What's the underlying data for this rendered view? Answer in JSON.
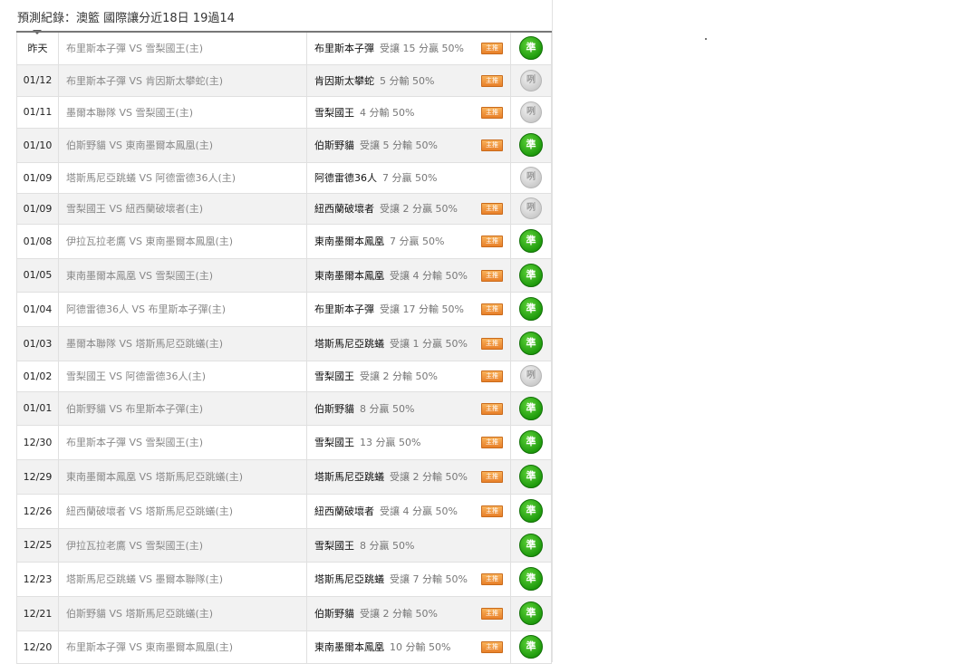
{
  "header": {
    "title": "預測紀錄：澳籃 國際讓分近18日 19過14"
  },
  "tag_label": "主推",
  "result_labels": {
    "win": "準",
    "draw": "咧"
  },
  "colors": {
    "win_green": "#1f9b0d",
    "draw_gray": "#c9c9c9",
    "tag_orange": "#e8802a"
  },
  "rows": [
    {
      "date": "昨天",
      "match": "布里斯本子彈 VS 雪梨國王(主)",
      "pick": "布里斯本子彈",
      "detail": "受讓 15 分贏 50%",
      "tag": true,
      "result": "win"
    },
    {
      "date": "01/12",
      "match": "布里斯本子彈 VS 肯因斯太攀蛇(主)",
      "pick": "肯因斯太攀蛇",
      "detail": "5 分輸 50%",
      "tag": true,
      "result": "draw"
    },
    {
      "date": "01/11",
      "match": "墨爾本聯隊 VS 雪梨國王(主)",
      "pick": "雪梨國王",
      "detail": "4 分輸 50%",
      "tag": true,
      "result": "draw"
    },
    {
      "date": "01/10",
      "match": "伯斯野貓 VS 東南墨爾本鳳凰(主)",
      "pick": "伯斯野貓",
      "detail": "受讓 5 分輸 50%",
      "tag": true,
      "result": "win"
    },
    {
      "date": "01/09",
      "match": "塔斯馬尼亞跳蟻 VS 阿德雷德36人(主)",
      "pick": "阿德雷德36人",
      "detail": "7 分贏 50%",
      "tag": false,
      "result": "draw"
    },
    {
      "date": "01/09",
      "match": "雪梨國王 VS 紐西蘭破壞者(主)",
      "pick": "紐西蘭破壞者",
      "detail": "受讓 2 分贏 50%",
      "tag": true,
      "result": "draw"
    },
    {
      "date": "01/08",
      "match": "伊拉瓦拉老鷹 VS 東南墨爾本鳳凰(主)",
      "pick": "東南墨爾本鳳凰",
      "detail": "7 分贏 50%",
      "tag": true,
      "result": "win"
    },
    {
      "date": "01/05",
      "match": "東南墨爾本鳳凰 VS 雪梨國王(主)",
      "pick": "東南墨爾本鳳凰",
      "detail": "受讓 4 分輸 50%",
      "tag": true,
      "result": "win"
    },
    {
      "date": "01/04",
      "match": "阿德雷德36人 VS 布里斯本子彈(主)",
      "pick": "布里斯本子彈",
      "detail": "受讓 17 分輸 50%",
      "tag": true,
      "result": "win"
    },
    {
      "date": "01/03",
      "match": "墨爾本聯隊 VS 塔斯馬尼亞跳蟻(主)",
      "pick": "塔斯馬尼亞跳蟻",
      "detail": "受讓 1 分贏 50%",
      "tag": true,
      "result": "win"
    },
    {
      "date": "01/02",
      "match": "雪梨國王 VS 阿德雷德36人(主)",
      "pick": "雪梨國王",
      "detail": "受讓 2 分輸 50%",
      "tag": true,
      "result": "draw"
    },
    {
      "date": "01/01",
      "match": "伯斯野貓 VS 布里斯本子彈(主)",
      "pick": "伯斯野貓",
      "detail": "8 分贏 50%",
      "tag": true,
      "result": "win"
    },
    {
      "date": "12/30",
      "match": "布里斯本子彈 VS 雪梨國王(主)",
      "pick": "雪梨國王",
      "detail": "13 分贏 50%",
      "tag": true,
      "result": "win"
    },
    {
      "date": "12/29",
      "match": "東南墨爾本鳳凰 VS 塔斯馬尼亞跳蟻(主)",
      "pick": "塔斯馬尼亞跳蟻",
      "detail": "受讓 2 分輸 50%",
      "tag": true,
      "result": "win"
    },
    {
      "date": "12/26",
      "match": "紐西蘭破壞者 VS 塔斯馬尼亞跳蟻(主)",
      "pick": "紐西蘭破壞者",
      "detail": "受讓 4 分贏 50%",
      "tag": true,
      "result": "win"
    },
    {
      "date": "12/25",
      "match": "伊拉瓦拉老鷹 VS 雪梨國王(主)",
      "pick": "雪梨國王",
      "detail": "8 分贏 50%",
      "tag": false,
      "result": "win"
    },
    {
      "date": "12/23",
      "match": "塔斯馬尼亞跳蟻 VS 墨爾本聯隊(主)",
      "pick": "塔斯馬尼亞跳蟻",
      "detail": "受讓 7 分輸 50%",
      "tag": true,
      "result": "win"
    },
    {
      "date": "12/21",
      "match": "伯斯野貓 VS 塔斯馬尼亞跳蟻(主)",
      "pick": "伯斯野貓",
      "detail": "受讓 2 分輸 50%",
      "tag": true,
      "result": "win"
    },
    {
      "date": "12/20",
      "match": "布里斯本子彈 VS 東南墨爾本鳳凰(主)",
      "pick": "東南墨爾本鳳凰",
      "detail": "10 分輸 50%",
      "tag": true,
      "result": "win"
    }
  ]
}
